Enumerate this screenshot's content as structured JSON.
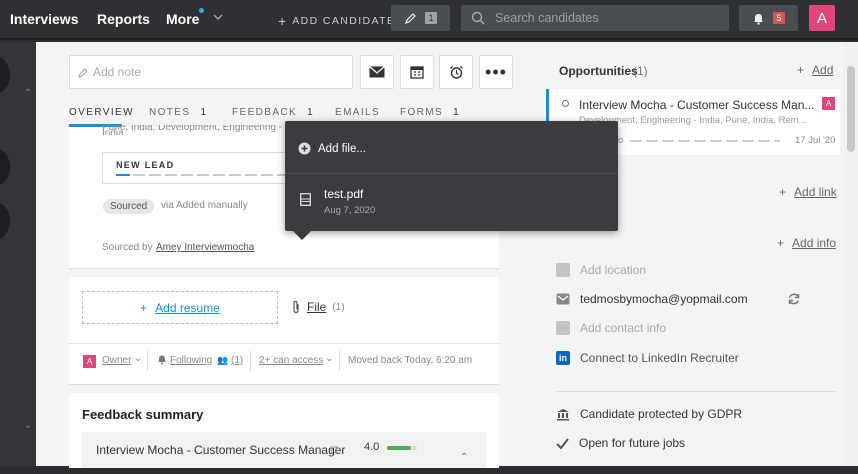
{
  "topbar": {
    "nav": [
      "Interviews",
      "Reports",
      "More"
    ],
    "add_candidate": "ADD CANDIDATE",
    "notes_count": "1",
    "search_placeholder": "Search candidates",
    "notif_count": "5",
    "avatar_letter": "A"
  },
  "left": {
    "add_note_placeholder": "Add note",
    "tabs": [
      {
        "label": "OVERVIEW",
        "count": ""
      },
      {
        "label": "NOTES",
        "count": "1"
      },
      {
        "label": "FEEDBACK",
        "count": "1"
      },
      {
        "label": "EMAILS",
        "count": ""
      },
      {
        "label": "FORMS",
        "count": "1"
      }
    ],
    "location_line": "Pune, India, Development, Engineering - India",
    "stage": "NEW LEAD",
    "sourced_badge": "Sourced",
    "sourced_via": "via Added manually",
    "sourced_by_label": "Sourced by",
    "sourced_by_name": "Amey Interviewmocha",
    "add_resume": "Add resume",
    "file_label": "File",
    "file_count": "(1)",
    "owner_avatar": "A",
    "owner_label": "Owner",
    "following_label": "Following",
    "following_count": "(1)",
    "can_access": "2+ can access",
    "moved_back": "Moved back Today, 6:20 am",
    "feedback_title": "Feedback summary",
    "feedback_item": "Interview Mocha - Customer Success Manager",
    "feedback_item_count": "(1",
    "feedback_score": "4.0",
    "feedback_score_fraction": 0.8,
    "accent": "#1a8fd6"
  },
  "popup": {
    "add_file": "Add file...",
    "file_name": "test.pdf",
    "file_date": "Aug 7, 2020"
  },
  "right": {
    "opportunities_title": "Opportunities",
    "opportunities_count": "(1)",
    "add_label": "Add",
    "opp_title": "Interview Mocha - Customer Success Man...",
    "opp_sub": "Development, Engineering - India, Pune, India, Rem...",
    "opp_badge": "A",
    "opp_stage_frag": "o",
    "opp_date": "17 Jul '20",
    "add_link": "Add link",
    "add_info": "Add info",
    "add_location": "Add location",
    "email": "tedmosbymocha@yopmail.com",
    "add_contact_info": "Add contact info",
    "linkedin": "Connect to LinkedIn Recruiter",
    "gdpr": "Candidate protected by GDPR",
    "open_jobs": "Open for future jobs"
  }
}
